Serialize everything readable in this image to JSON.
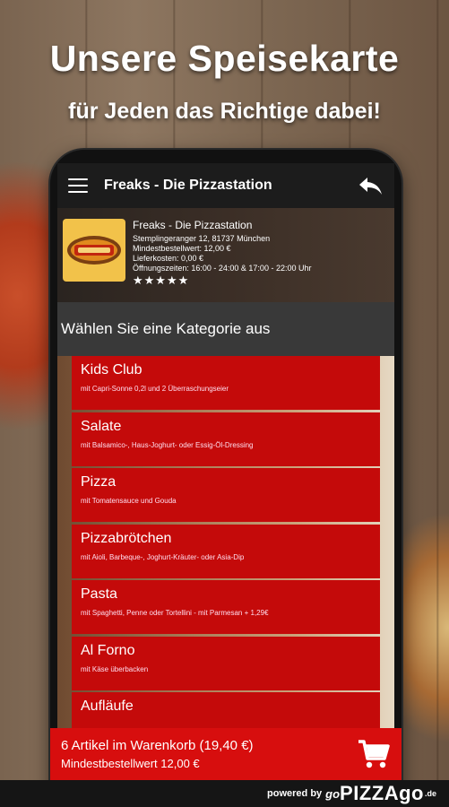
{
  "promo": {
    "headline": "Unsere Speisekarte",
    "subheadline": "für Jeden das Richtige dabei!"
  },
  "appbar": {
    "title": "Freaks - Die Pizzastation",
    "menu_icon": "hamburger-menu-icon",
    "back_icon": "back-arrow-icon"
  },
  "shop": {
    "name": "Freaks - Die Pizzastation",
    "address": "Stemplingeranger 12, 81737 München",
    "min_order": "Mindestbestellwert: 12,00 €",
    "delivery_cost": "Lieferkosten: 0,00 €",
    "opening_hours": "Öffnungszeiten: 16:00 - 24:00 & 17:00 - 22:00 Uhr",
    "rating_stars": "★★★★★",
    "rating_value": 5
  },
  "category_header": "Wählen Sie eine Kategorie aus",
  "categories": [
    {
      "title": "Kids Club",
      "desc": "mit Capri-Sonne 0,2l und 2 Überraschungseier"
    },
    {
      "title": "Salate",
      "desc": "mit Balsamico-, Haus-Joghurt- oder Essig-Öl-Dressing"
    },
    {
      "title": "Pizza",
      "desc": "mit Tomatensauce und Gouda"
    },
    {
      "title": "Pizzabrötchen",
      "desc": "mit Aioli, Barbeque-, Joghurt-Kräuter- oder Asia-Dip"
    },
    {
      "title": "Pasta",
      "desc": "mit Spaghetti, Penne oder Tortellini - mit Parmesan + 1,29€"
    },
    {
      "title": "Al Forno",
      "desc": "mit Käse überbacken"
    },
    {
      "title": "Aufläufe",
      "desc": ""
    }
  ],
  "cart": {
    "summary": "6 Artikel im Warenkorb (19,40 €)",
    "min_order": "Mindestbestellwert 12,00 €",
    "icon": "shopping-cart-icon"
  },
  "footer": {
    "powered_by": "powered by",
    "brand_go": "go",
    "brand_pizza": "PIZZAgo",
    "brand_tld": ".de"
  },
  "colors": {
    "accent_red": "#c40a0a",
    "cart_red": "#d70e0e",
    "appbar": "#1c1c1c"
  }
}
